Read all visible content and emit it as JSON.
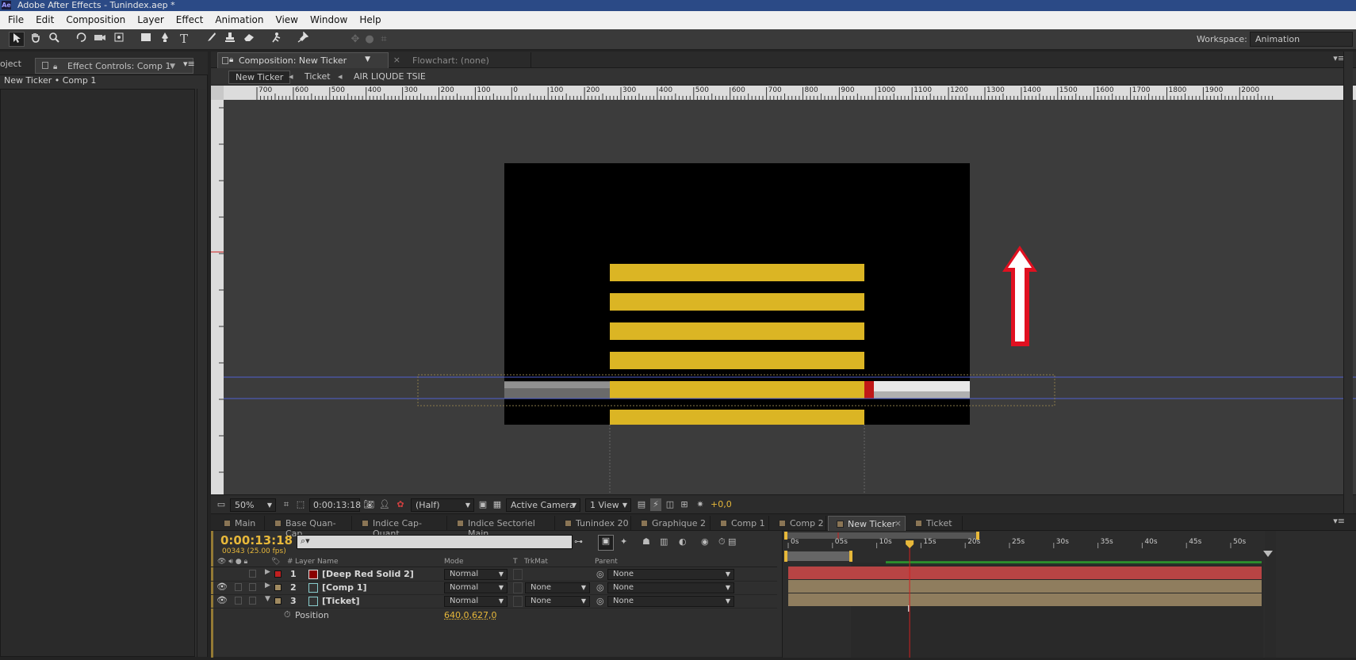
{
  "window": {
    "title": "Adobe After Effects - Tunindex.aep *",
    "app_icon": "Ae"
  },
  "menu": [
    "File",
    "Edit",
    "Composition",
    "Layer",
    "Effect",
    "Animation",
    "View",
    "Window",
    "Help"
  ],
  "toolbar": {
    "workspace_label": "Workspace:",
    "workspace_value": "Animation"
  },
  "left_panel": {
    "project_tab": "oject",
    "effect_tab": "Effect Controls: Comp 1",
    "subtitle": "New Ticker • Comp 1"
  },
  "composition_panel": {
    "tab_active": "Composition: New Ticker",
    "tab_flowchart": "Flowchart: (none)",
    "breadcrumbs": [
      "New Ticker",
      "Ticket",
      "AIR LIQUDE TSIE"
    ],
    "ruler_labels": [
      "700",
      "600",
      "500",
      "400",
      "300",
      "200",
      "100",
      "0",
      "100",
      "200",
      "300",
      "400",
      "500",
      "600",
      "700",
      "800",
      "900",
      "1000",
      "1100",
      "1200",
      "1300",
      "1400",
      "1500",
      "1600",
      "1700",
      "1800",
      "1900",
      "2000"
    ],
    "viewer_colors": {
      "canvas": "#000000",
      "bars": "#dbb524",
      "arrow": "#e01020",
      "guide": "#5060d0"
    },
    "bottom": {
      "zoom": "50%",
      "time": "0:00:13:18",
      "resolution": "(Half)",
      "camera": "Active Camera",
      "views": "1 View",
      "exposure": "+0,0"
    }
  },
  "timeline": {
    "tabs": [
      "Main",
      "Base Quan-Cap",
      "Indice Cap-Quant",
      "Indice Sectoriel Main",
      "Tunindex 20",
      "Graphique 2",
      "Comp 1",
      "Comp 2",
      "New Ticker",
      "Ticket"
    ],
    "active_tab": "New Ticker",
    "timecode": "0:00:13:18",
    "fps": "00343 (25.00 fps)",
    "columns": {
      "num": "#",
      "layer_name": "Layer Name",
      "mode": "Mode",
      "t": "T",
      "trkmat": "TrkMat",
      "parent": "Parent"
    },
    "layers": [
      {
        "num": "1",
        "name": "[Deep Red Solid 2]",
        "mode": "Normal",
        "trkmat": "",
        "parent": "None",
        "label_color": "#c02020"
      },
      {
        "num": "2",
        "name": "[Comp 1]",
        "mode": "Normal",
        "trkmat": "None",
        "parent": "None",
        "label_color": "#a08a60"
      },
      {
        "num": "3",
        "name": "[Ticket]",
        "mode": "Normal",
        "trkmat": "None",
        "parent": "None",
        "label_color": "#a08a60"
      }
    ],
    "property": {
      "name": "Position",
      "value": "640,0,627,0"
    },
    "time_ruler": [
      "0s",
      "05s",
      "10s",
      "15s",
      "20s",
      "25s",
      "30s",
      "35s",
      "40s",
      "45s",
      "50s"
    ],
    "playhead_seconds": 13.72
  }
}
